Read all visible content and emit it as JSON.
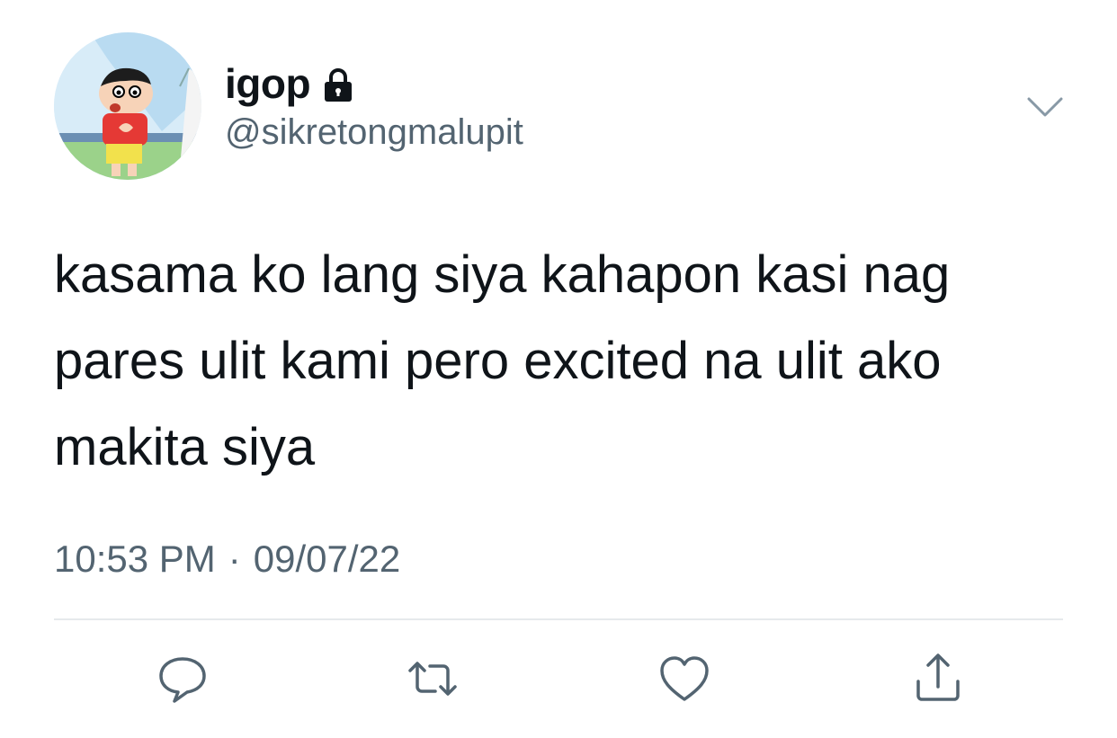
{
  "user": {
    "display_name": "igop",
    "handle": "@sikretongmalupit",
    "protected_icon": "lock-icon"
  },
  "tweet": {
    "text": "kasama ko lang siya kahapon kasi nag\npares ulit kami pero excited na ulit ako\nmakita siya",
    "time": "10:53 PM",
    "separator": "·",
    "date": "09/07/22"
  },
  "actions": [
    {
      "name": "reply",
      "icon": "comment-icon"
    },
    {
      "name": "retweet",
      "icon": "retweet-icon"
    },
    {
      "name": "like",
      "icon": "heart-icon"
    },
    {
      "name": "share",
      "icon": "share-icon"
    }
  ],
  "colors": {
    "text_primary": "#0f1419",
    "text_secondary": "#536471",
    "icon_gray": "#536471",
    "divider": "#e6e9ec"
  }
}
